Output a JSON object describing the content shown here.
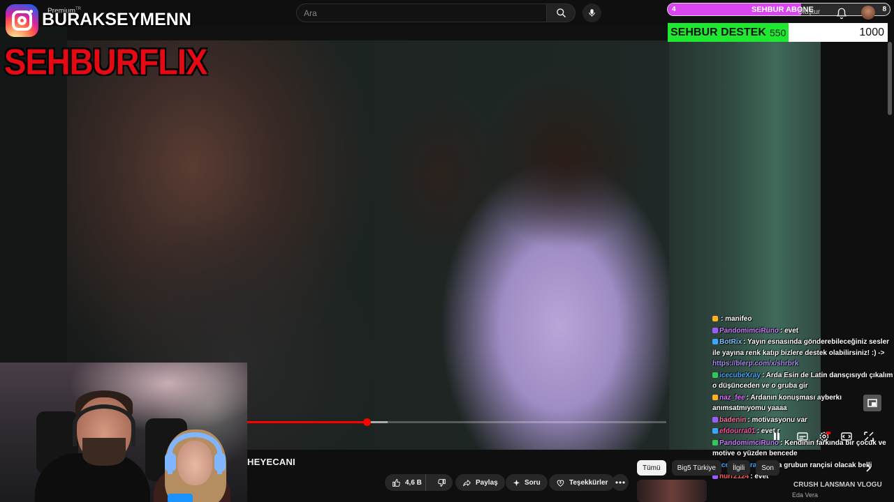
{
  "header": {
    "search_placeholder": "Ara",
    "premium_label": "Premium",
    "premium_region": "TR",
    "create_label": "Oluştur"
  },
  "overlay": {
    "channel_name": "BURAKSEYMENN",
    "brand": "SEHBURFLIX",
    "sub_goal": {
      "current": "4",
      "title": "SEHBUR ABONE",
      "target": "8",
      "fraction": 0.6,
      "color": "#d946ef"
    },
    "donation_goal": {
      "title": "SEHBUR DESTEK",
      "current": "550",
      "target": "1000",
      "fraction": 0.55,
      "color": "#1ee830"
    }
  },
  "player": {
    "progress_played": 0.285,
    "progress_buffered": 0.335,
    "accent": "#ff0000"
  },
  "video": {
    "title": "HEYECANI",
    "like_count": "4,6 B",
    "share_label": "Paylaş",
    "ask_label": "Soru",
    "thanks_label": "Teşekkürler"
  },
  "chips": {
    "items": [
      "Tümü",
      "Big5 Türkiye",
      "İlgili",
      "Son"
    ]
  },
  "recommendation": {
    "title": "CRUSH LANSMAN VLOGU",
    "channel": "Eda Vera"
  },
  "chat": {
    "messages": [
      {
        "user": "",
        "text": ": manifeo",
        "user_color": "#ff5c5c"
      },
      {
        "user": "PandomimciRuno",
        "text": ": evet",
        "user_color": "#c77dff"
      },
      {
        "user": "BotRix",
        "text": ": Yayın esnasında gönderebileceğiniz sesler ile yayına renk katıp bizlere destek olabilirsiniz! :) ->",
        "link": "https://blerp.com/x/shrbrk",
        "user_color": "#7ec3ff"
      },
      {
        "user": "icecubeXray",
        "text": ": Arda Esin de Latin dansçısıydı çıkalım o düşünceden ve o gruba gir",
        "user_color": "#3ea6ff"
      },
      {
        "user": "naz_fee",
        "text": ": Ardanın konuşması ayberkı anımsatmıyomu yaaaa",
        "user_color": "#e06cff"
      },
      {
        "user": "badenin",
        "text": ": motivasyonu var",
        "user_color": "#ff6b9d"
      },
      {
        "user": "efdourra01",
        "text": ": evet r",
        "user_color": "#ff4fa3"
      },
      {
        "user": "PandomimciRuno",
        "text": ": Kendinin farkında bir çocuk ve motive o yüzden bencede",
        "user_color": "#c77dff"
      },
      {
        "user": "icecubeXray",
        "text": ": Arda grubun rançisi olacak belli",
        "user_color": "#3ea6ff"
      },
      {
        "user": "nurr2124",
        "text": ": evet",
        "user_color": "#ff5c5c"
      }
    ]
  },
  "icons": {
    "search": "search-icon",
    "mic": "microphone-icon",
    "bell": "bell-icon",
    "like": "thumbs-up-icon",
    "dislike": "thumbs-down-icon",
    "share": "share-icon",
    "ask": "sparkle-icon",
    "thanks": "dollar-heart-icon",
    "more": "more-horizontal-icon"
  }
}
